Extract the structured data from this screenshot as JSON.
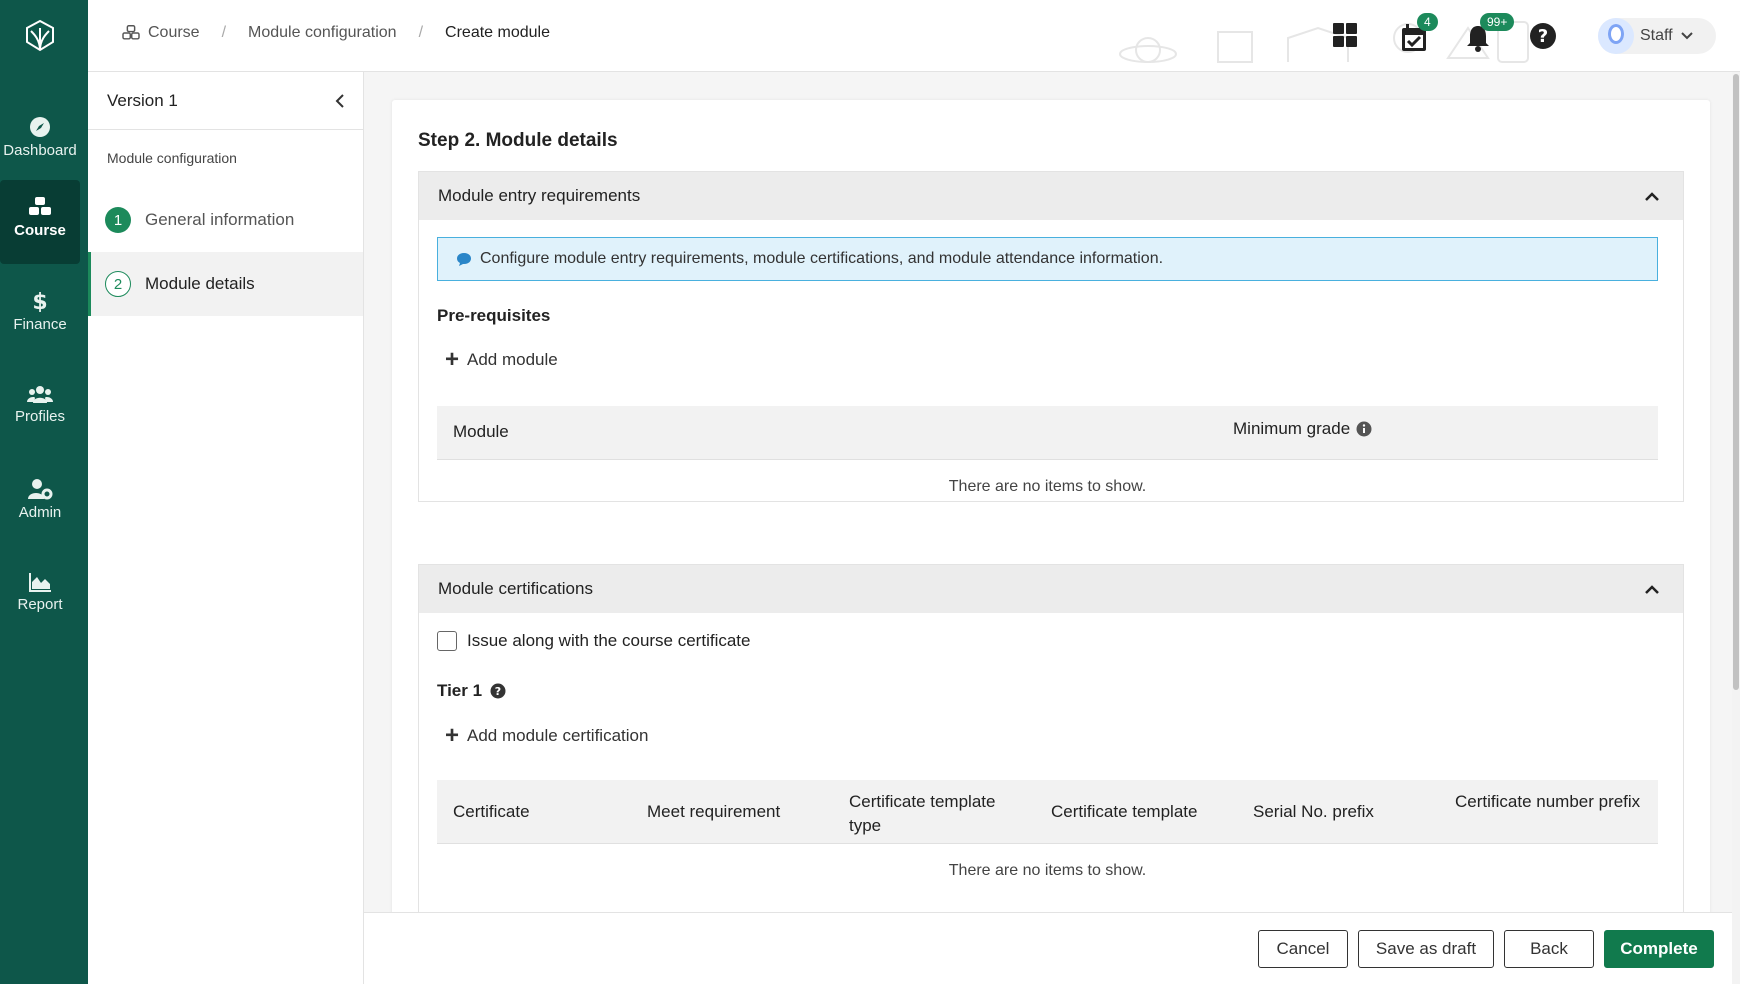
{
  "nav": {
    "items": [
      {
        "label": "Dashboard",
        "icon": "compass-icon"
      },
      {
        "label": "Course",
        "icon": "course-icon"
      },
      {
        "label": "Finance",
        "icon": "dollar-icon"
      },
      {
        "label": "Profiles",
        "icon": "users-icon"
      },
      {
        "label": "Admin",
        "icon": "user-gear-icon"
      },
      {
        "label": "Report",
        "icon": "area-chart-icon"
      }
    ],
    "active": "Course"
  },
  "breadcrumb": {
    "items": [
      "Course",
      "Module configuration",
      "Create module"
    ]
  },
  "header": {
    "tasks_badge": "4",
    "notifications_badge": "99+",
    "user_name": "Staff"
  },
  "stepbar": {
    "version": "Version 1",
    "section": "Module configuration",
    "steps": [
      {
        "num": "1",
        "label": "General information"
      },
      {
        "num": "2",
        "label": "Module details"
      }
    ]
  },
  "main": {
    "title": "Step 2. Module details",
    "entry": {
      "title": "Module entry requirements",
      "info": "Configure module entry requirements, module certifications, and module attendance information.",
      "prereq_title": "Pre-requisites",
      "add_label": "Add module",
      "columns": [
        "Module",
        "Minimum grade"
      ],
      "empty": "There are no items to show."
    },
    "certs": {
      "title": "Module certifications",
      "checkbox_label": "Issue along with the course certificate",
      "tier_title": "Tier 1",
      "add_label": "Add module certification",
      "columns": [
        "Certificate",
        "Meet requirement",
        "Certificate template type",
        "Certificate template",
        "Serial No. prefix",
        "Certificate number prefix"
      ],
      "empty": "There are no items to show."
    }
  },
  "footer": {
    "cancel": "Cancel",
    "save_draft": "Save as draft",
    "back": "Back",
    "complete": "Complete"
  },
  "colors": {
    "brand": "#0e574a",
    "accent": "#1c8a5b",
    "info_bg": "#e0f2fb"
  }
}
